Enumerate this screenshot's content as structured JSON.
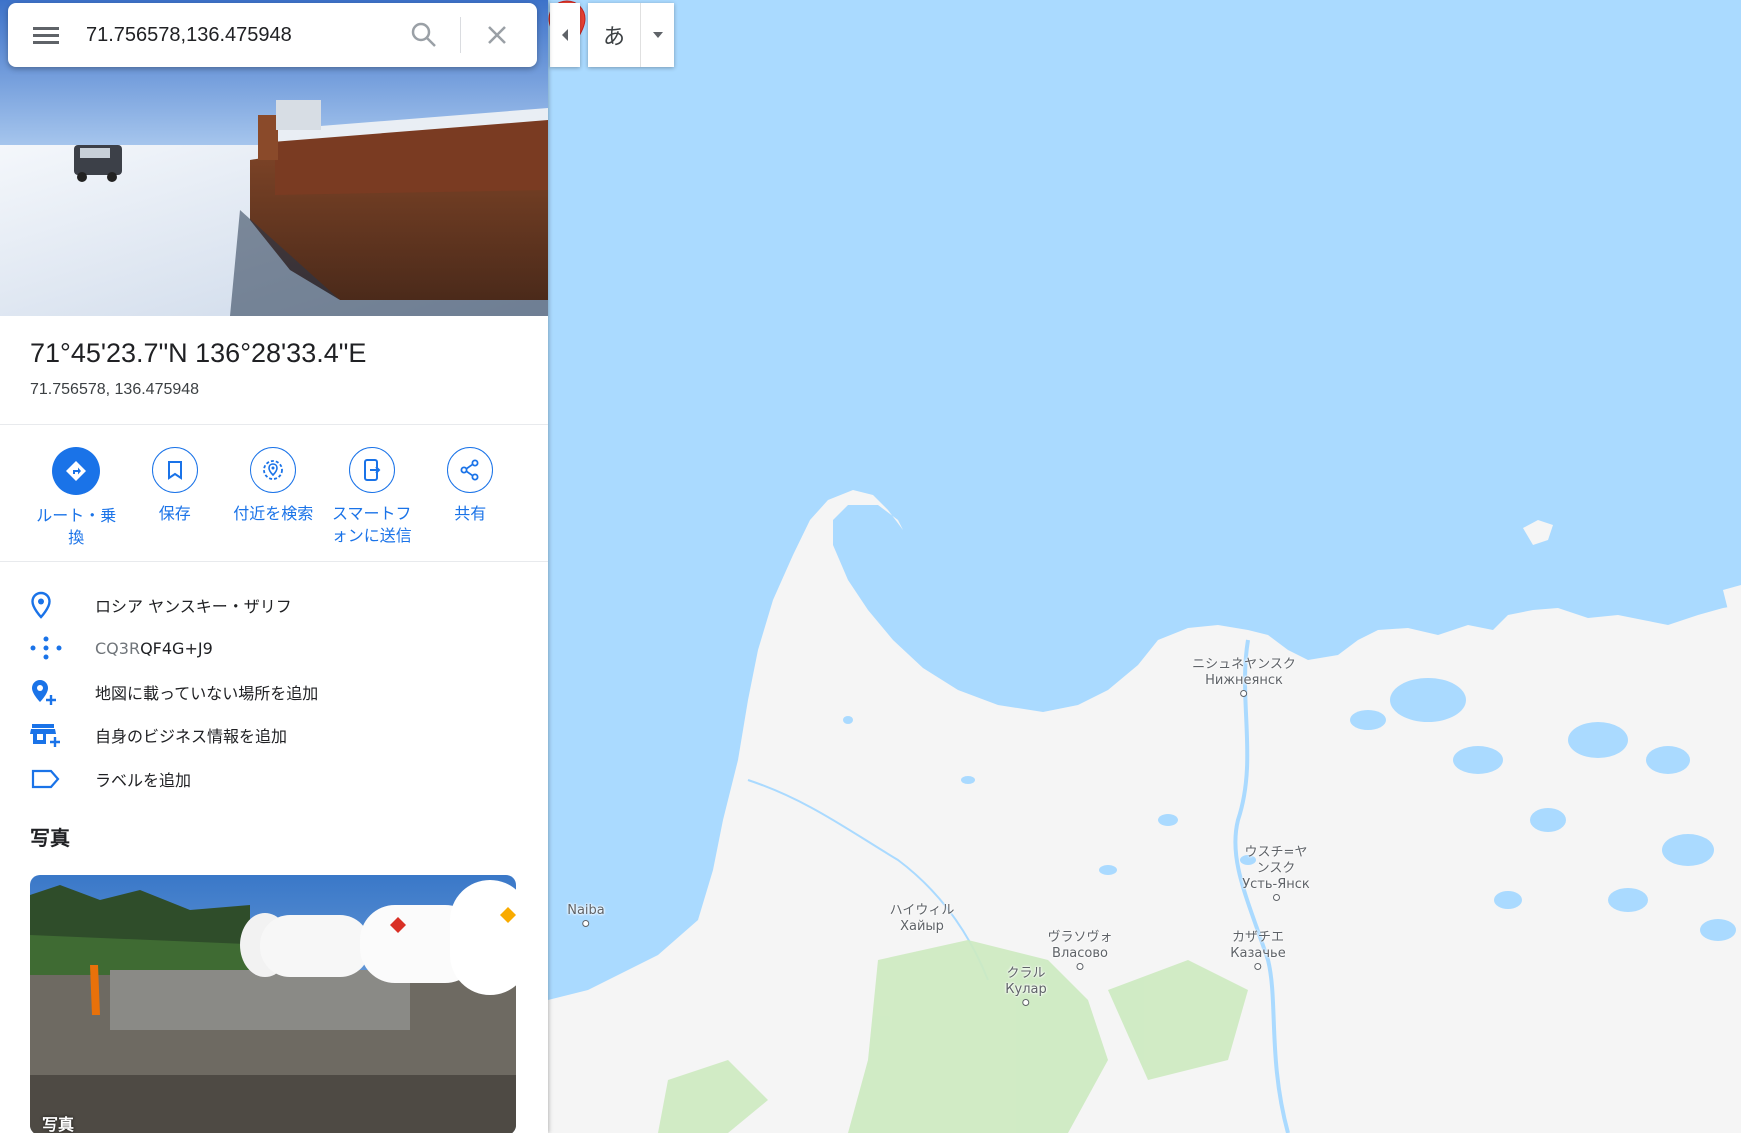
{
  "search": {
    "query": "71.756578,136.475948",
    "menu_icon": "hamburger-menu-icon",
    "search_icon": "search-icon",
    "clear_icon": "close-icon"
  },
  "panel": {
    "title": "71°45'23.7\"N 136°28'33.4\"E",
    "subtitle": "71.756578, 136.475948",
    "actions": [
      {
        "label": "ルート・乗換",
        "icon": "directions-icon"
      },
      {
        "label": "保存",
        "icon": "bookmark-icon"
      },
      {
        "label": "付近を検索",
        "icon": "search-nearby-icon"
      },
      {
        "label": "スマートフォンに送信",
        "icon": "send-to-phone-icon"
      },
      {
        "label": "共有",
        "icon": "share-icon"
      }
    ],
    "info": {
      "address": "ロシア ヤンスキー・ザリフ",
      "pluscode_prefix": "CQ3R",
      "pluscode": "QF4G+J9",
      "add_missing_place": "地図に載っていない場所を追加",
      "add_business": "自身のビジネス情報を追加",
      "add_label": "ラベルを追加"
    },
    "photos_heading": "写真",
    "photo_label": "写真"
  },
  "controls": {
    "ime_char": "あ",
    "collapse_icon": "chevron-left-icon",
    "ime_dropdown_icon": "caret-down-icon"
  },
  "map": {
    "labels": [
      {
        "ja": "ニシュネヤンスク",
        "ru": "Нижнеянск"
      },
      {
        "ja": "ウスチ=ヤンスク",
        "ru": "Усть-Янск"
      },
      {
        "ja": "ハイウィル",
        "ru": "Хайыр"
      },
      {
        "ja": "ヴラソヴォ",
        "ru": "Власово"
      },
      {
        "ja": "カザチエ",
        "ru": "Казачье"
      },
      {
        "ja": "クラル",
        "ru": "Кулар"
      },
      {
        "ja": "",
        "ru": "Naiba"
      }
    ],
    "colors": {
      "water": "#aadaff",
      "land": "#f5f5f5",
      "vegetation": "#cdeac0",
      "pin": "#ea4335"
    }
  }
}
